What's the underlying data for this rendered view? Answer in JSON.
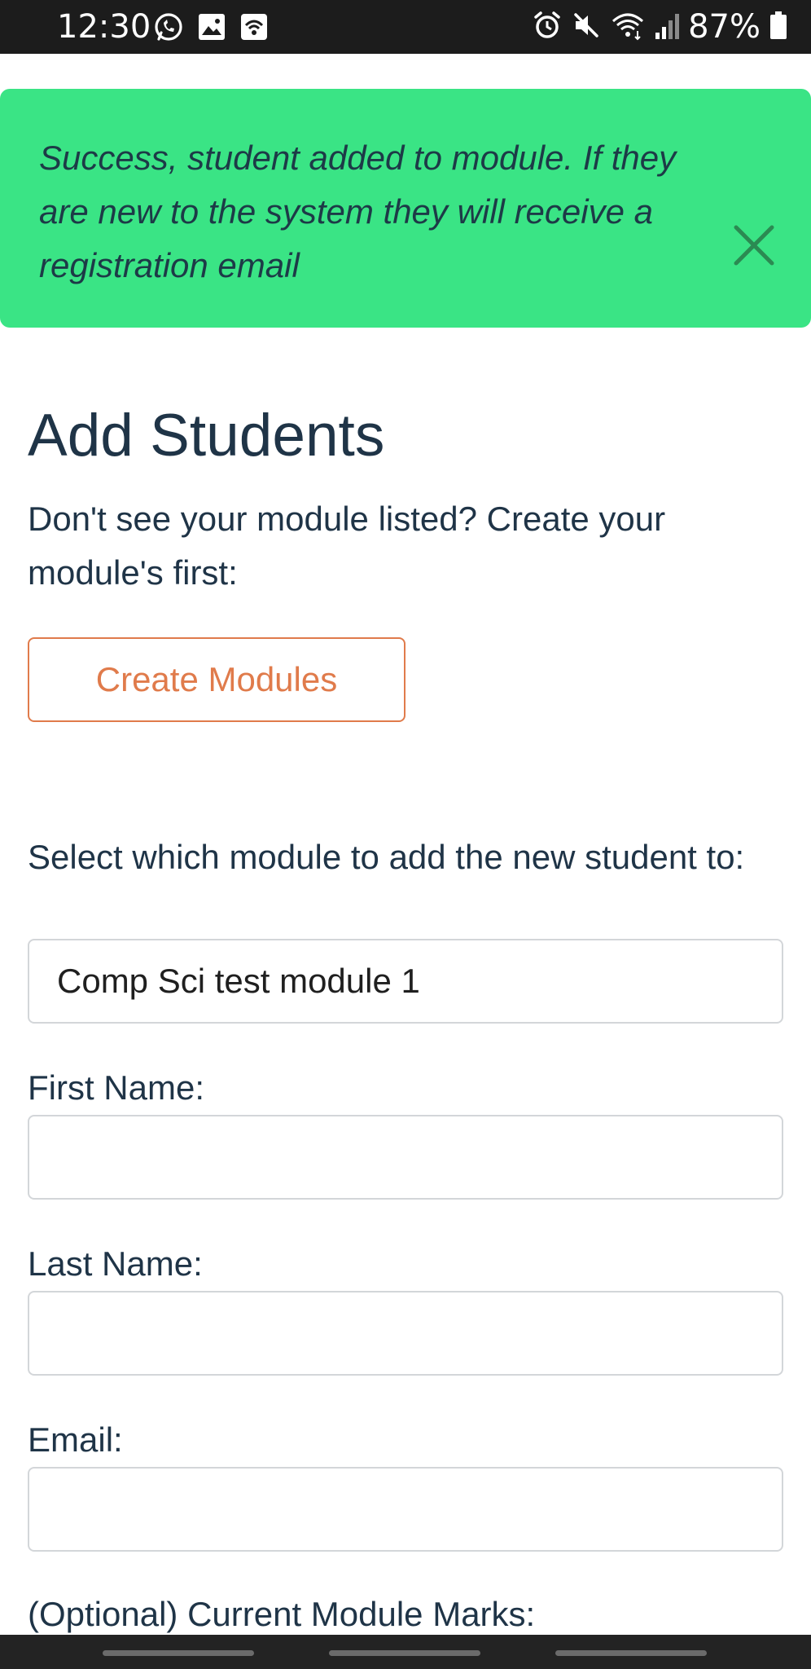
{
  "status_bar": {
    "time": "12:30",
    "battery": "87%",
    "left_icons": [
      "whatsapp-icon",
      "image-icon",
      "wifi-hotspot-icon"
    ],
    "right_icons": [
      "alarm-icon",
      "mute-icon",
      "wifi-icon",
      "signal-icon",
      "battery-icon"
    ]
  },
  "alert": {
    "message": "Success, student added to module. If they are new to the system they will receive a registration email",
    "close_icon": "close-icon",
    "color": "#3ae485"
  },
  "page": {
    "title": "Add Students",
    "intro": "Don't see your module listed? Create your module's first:",
    "create_button": "Create Modules"
  },
  "form": {
    "module_label": "Select which module to add the new student to:",
    "module_value": "Comp Sci test module 1",
    "first_name_label": "First Name:",
    "first_name_value": "",
    "last_name_label": "Last Name:",
    "last_name_value": "",
    "email_label": "Email:",
    "email_value": "",
    "marks_label": "(Optional) Current Module Marks:"
  },
  "colors": {
    "accent": "#e07b4b",
    "text": "#1f3447"
  }
}
